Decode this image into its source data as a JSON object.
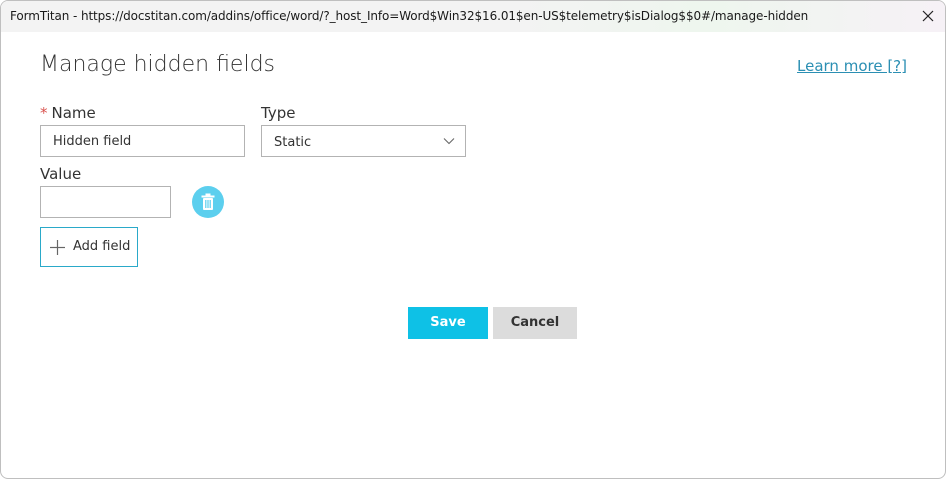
{
  "window": {
    "title": "FormTitan - https://docstitan.com/addins/office/word/?_host_Info=Word$Win32$16.01$en-US$telemetry$isDialog$$0#/manage-hidden"
  },
  "header": {
    "title": "Manage hidden fields",
    "learn_more": "Learn more [?]"
  },
  "form": {
    "name_required_marker": "*",
    "name_label": "Name",
    "name_value": "Hidden field",
    "type_label": "Type",
    "type_selected": "Static",
    "value_label": "Value",
    "value_value": ""
  },
  "actions": {
    "add_field": "Add field",
    "save": "Save",
    "cancel": "Cancel"
  },
  "colors": {
    "accent": "#0ec1e6",
    "delete_button": "#5ccfee",
    "link": "#2b8fb3",
    "required": "#d9534f"
  },
  "icons": {
    "close": "close-icon",
    "dropdown": "chevron-down-icon",
    "delete": "trash-icon",
    "add": "plus-icon"
  }
}
